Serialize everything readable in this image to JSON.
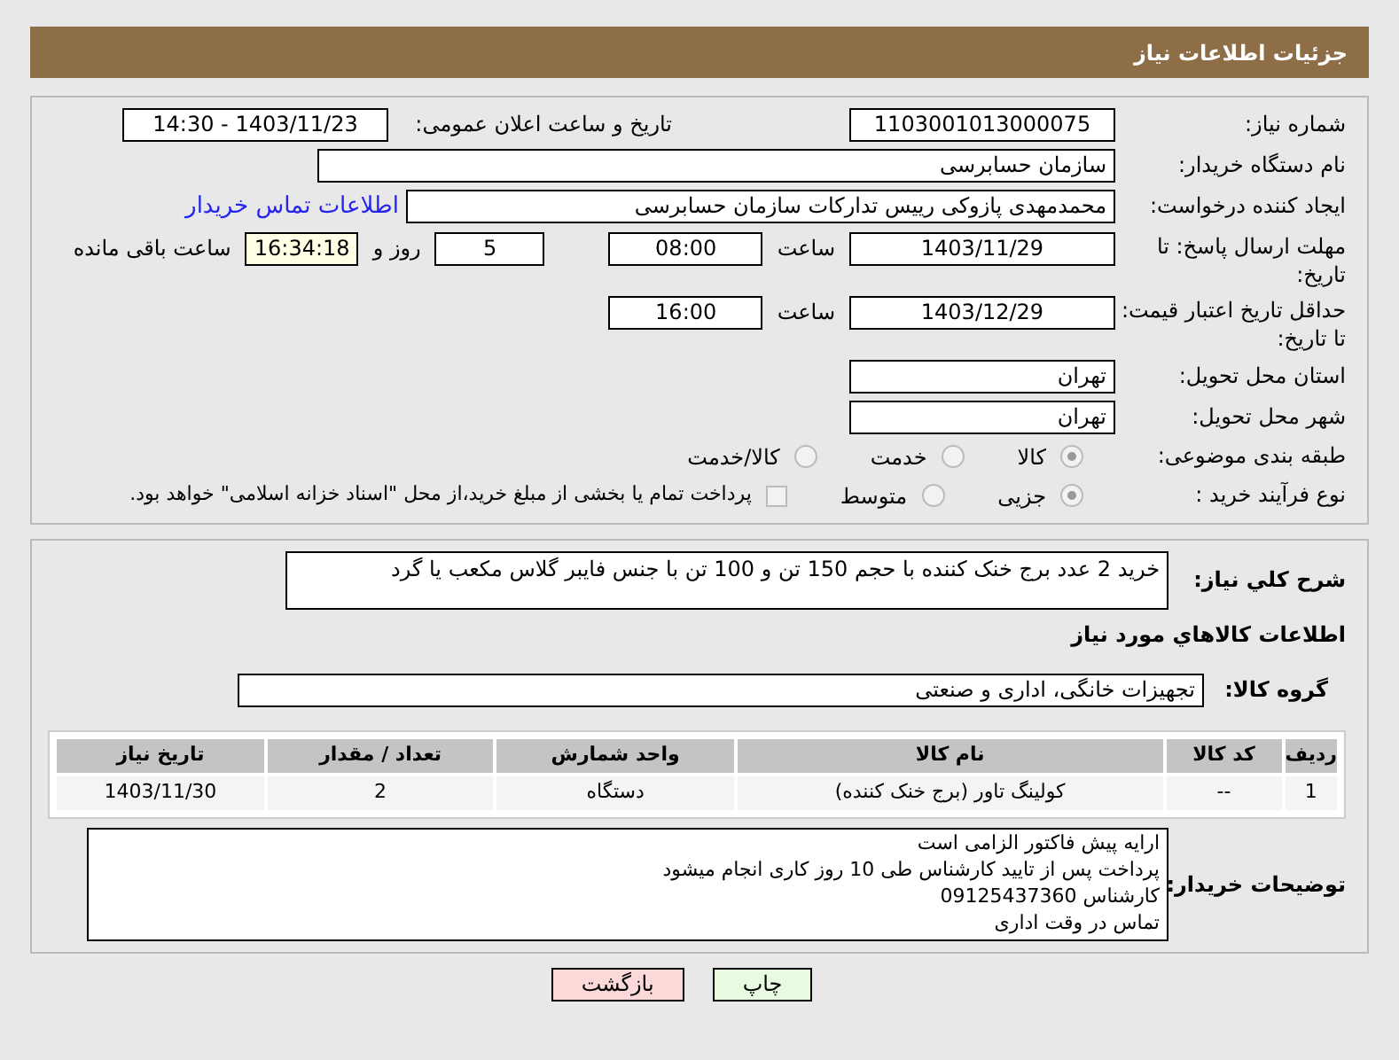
{
  "header": {
    "title": "جزئیات اطلاعات نیاز"
  },
  "fields": {
    "need_number": {
      "label": "شماره نیاز:",
      "value": "1103001013000075"
    },
    "announce": {
      "label": "تاریخ و ساعت اعلان عمومی:",
      "value": "1403/11/23 - 14:30"
    },
    "buyer": {
      "label": "نام دستگاه خریدار:",
      "value": "سازمان حسابرسی"
    },
    "creator": {
      "label": "ایجاد کننده درخواست:",
      "value": "محمدمهدی پازوکی رییس تدارکات سازمان حسابرسی",
      "link": "اطلاعات تماس خریدار"
    },
    "deadline": {
      "label": "مهلت ارسال پاسخ: تا تاریخ:",
      "date": "1403/11/29",
      "time_label": "ساعت",
      "time": "08:00",
      "days": "5",
      "days_label": "روز و",
      "remaining": "16:34:18",
      "remaining_label": "ساعت باقی مانده"
    },
    "validity": {
      "label": "حداقل تاریخ اعتبار قیمت: تا تاریخ:",
      "date": "1403/12/29",
      "time_label": "ساعت",
      "time": "16:00"
    },
    "province": {
      "label": "استان محل تحویل:",
      "value": "تهران"
    },
    "city": {
      "label": "شهر محل تحویل:",
      "value": "تهران"
    },
    "category": {
      "label": "طبقه بندی موضوعی:",
      "options": [
        {
          "label": "کالا",
          "selected": true
        },
        {
          "label": "خدمت",
          "selected": false
        },
        {
          "label": "کالا/خدمت",
          "selected": false
        }
      ]
    },
    "process": {
      "label": "نوع فرآیند خرید :",
      "options": [
        {
          "label": "جزیی",
          "selected": true
        },
        {
          "label": "متوسط",
          "selected": false
        }
      ],
      "payment": {
        "label": "پرداخت تمام یا بخشی از مبلغ خرید،از محل \"اسناد خزانه اسلامی\" خواهد بود.",
        "checked": false
      }
    }
  },
  "description": {
    "label": "شرح کلي نياز:",
    "value": "خرید 2 عدد برج خنک کننده با حجم 150 تن و 100 تن با جنس فایبر گلاس مکعب یا گرد"
  },
  "goods_heading": "اطلاعات کالاهاي مورد نياز",
  "goods_group": {
    "label": "گروه کالا:",
    "value": "تجهیزات خانگی، اداری و صنعتی"
  },
  "table": {
    "columns": [
      "ردیف",
      "کد کالا",
      "نام کالا",
      "واحد شمارش",
      "تعداد / مقدار",
      "تاریخ نیاز"
    ],
    "rows": [
      [
        "1",
        "--",
        "کولینگ تاور (برج خنک کننده)",
        "دستگاه",
        "2",
        "1403/11/30"
      ]
    ]
  },
  "notes": {
    "label": "توضیحات خریدار:",
    "lines": [
      "ارایه پیش فاکتور الزامی است",
      "پرداخت پس از تایید کارشناس طی 10 روز کاری انجام میشود",
      "کارشناس 09125437360",
      "تماس در وقت اداری"
    ]
  },
  "buttons": [
    {
      "label": "چاپ",
      "kind": "print"
    },
    {
      "label": "بازگشت",
      "kind": "back"
    }
  ]
}
